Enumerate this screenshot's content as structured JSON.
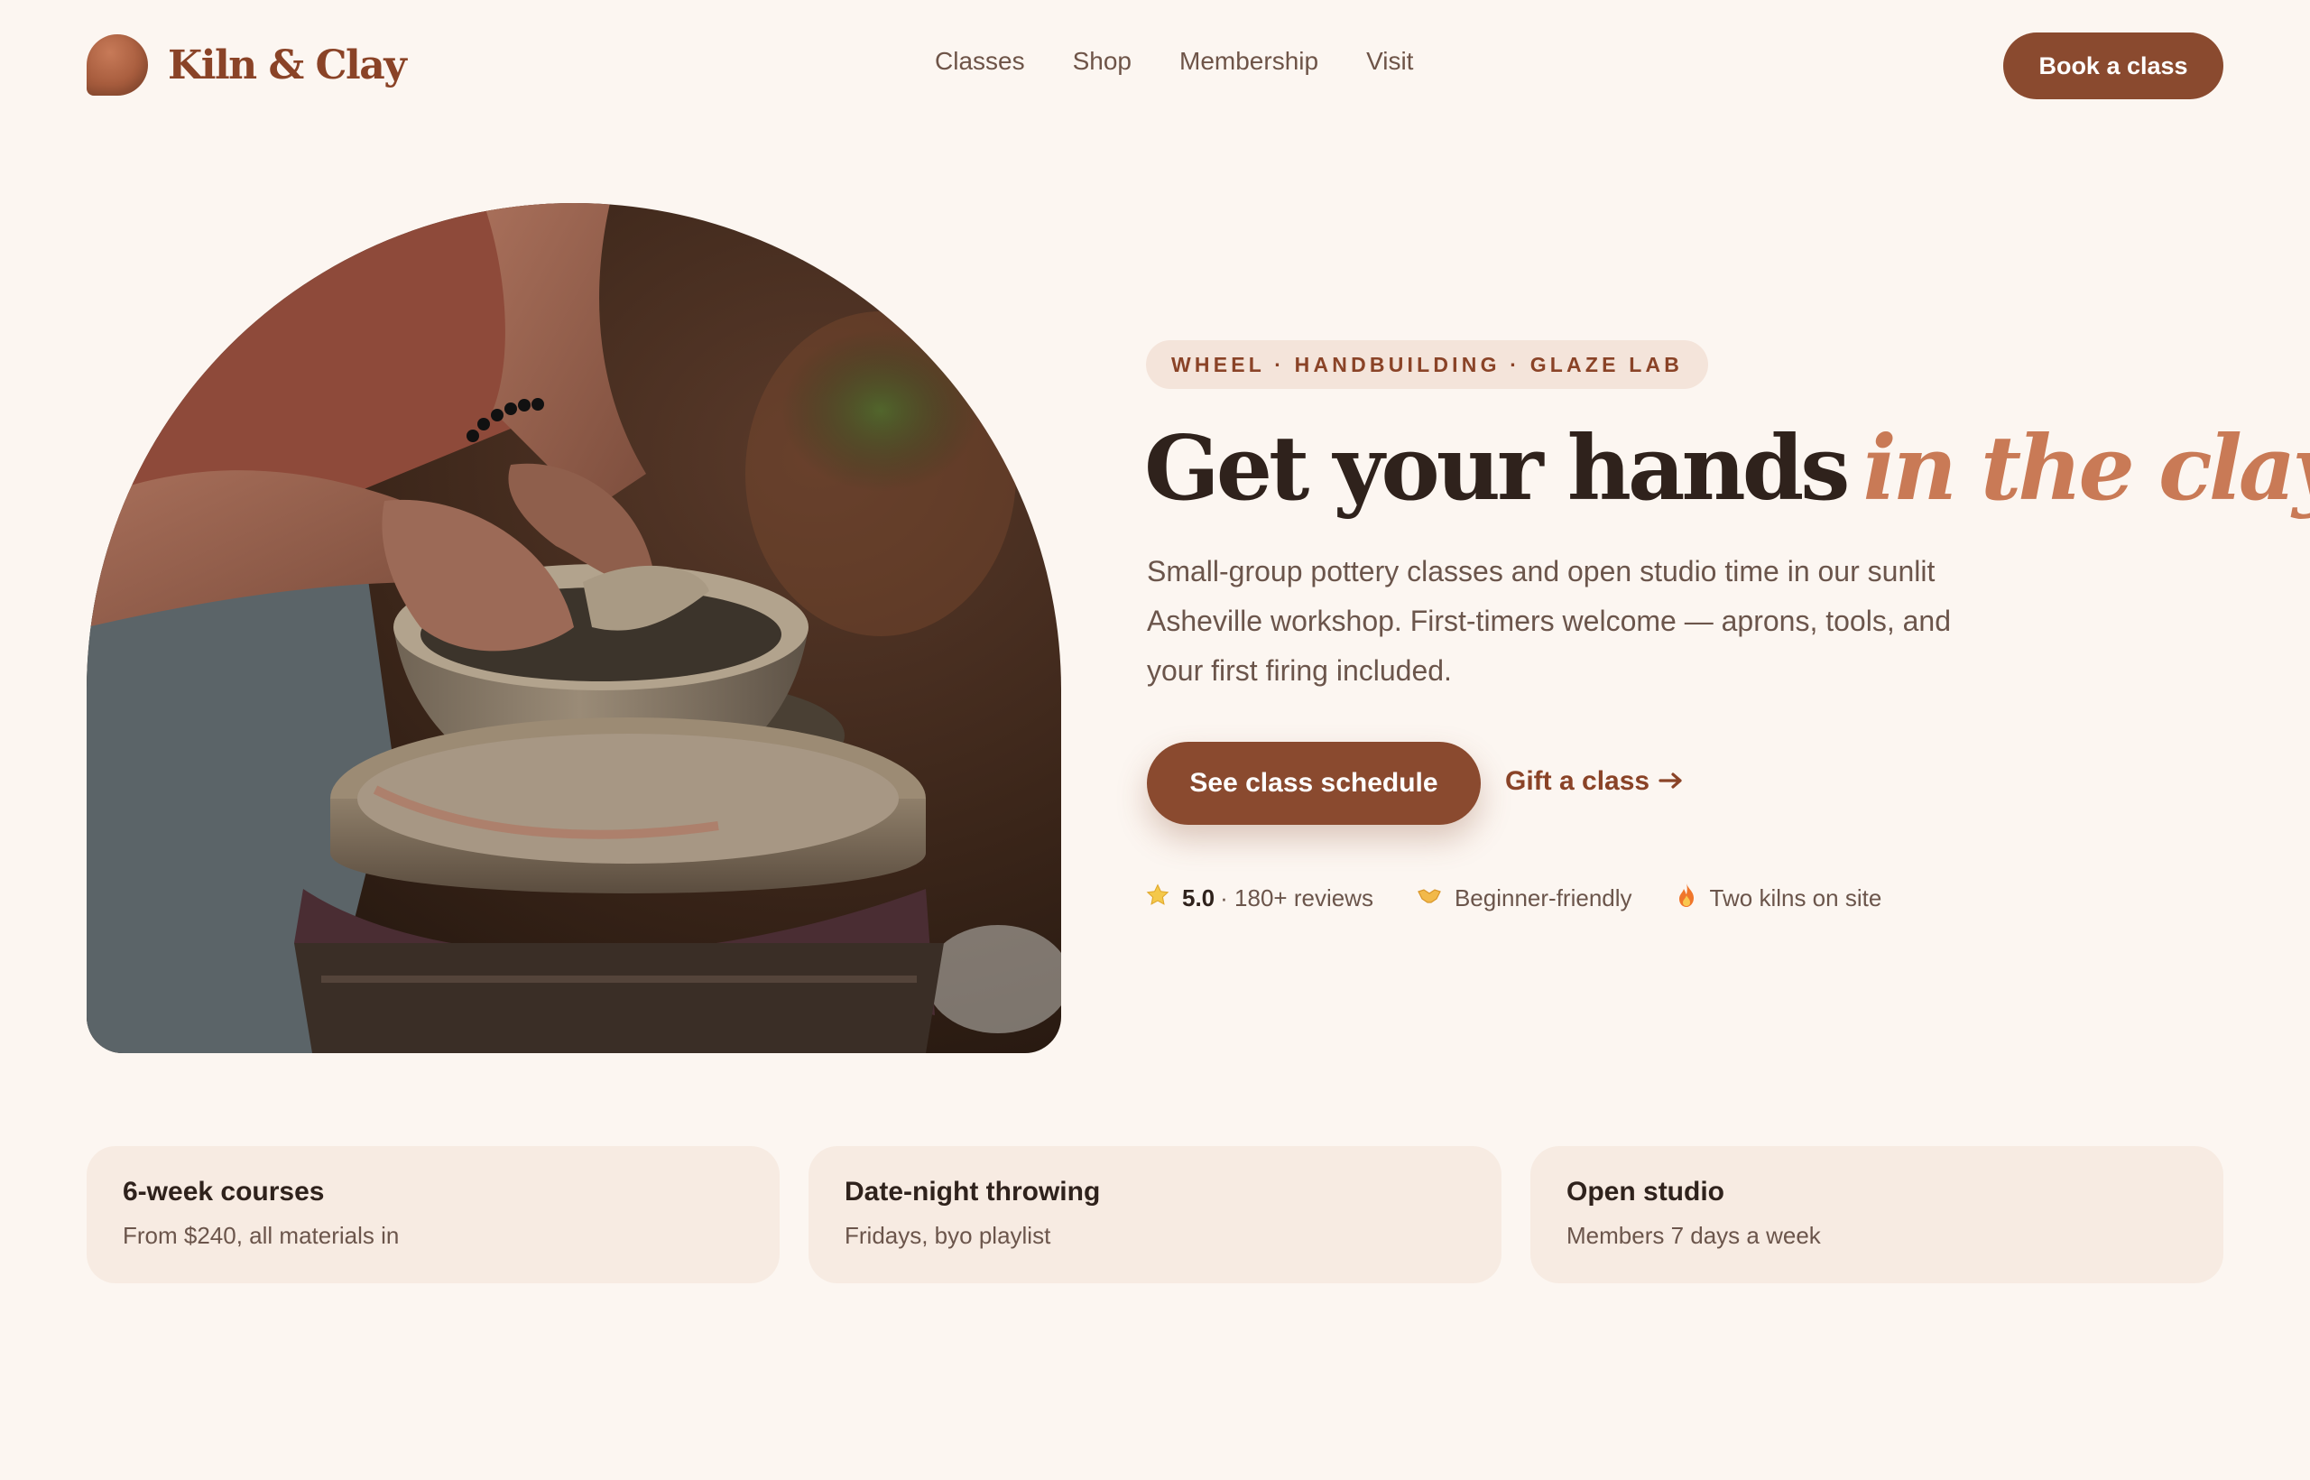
{
  "brand": {
    "name": "Kiln & Clay",
    "accent": "#8a4a2f",
    "accent_light": "#c97a56",
    "background": "#fcf6f1"
  },
  "nav": {
    "items": [
      "Classes",
      "Shop",
      "Membership",
      "Visit"
    ]
  },
  "header": {
    "cta_label": "Book a class"
  },
  "hero": {
    "tagline": "WHEEL · HANDBUILDING · GLAZE LAB",
    "headline_main": "Get your hands",
    "headline_accent": "in the clay",
    "description": "Small-group pottery classes and open studio time in our sunlit Asheville workshop. First-timers welcome — aprons, tools, and your first firing included.",
    "primary_cta": "See class schedule",
    "secondary_cta": "Gift a class",
    "secondary_cta_icon": "arrow-right-icon",
    "image_icon": "pottery-wheel-photo"
  },
  "stats": [
    {
      "icon": "star-icon",
      "strong": "5.0",
      "text": "· 180+ reviews"
    },
    {
      "icon": "handshake-icon",
      "strong": "",
      "text": "Beginner-friendly"
    },
    {
      "icon": "fire-icon",
      "strong": "",
      "text": "Two kilns on site"
    }
  ],
  "cards": [
    {
      "title": "6-week courses",
      "subtitle": "From $240, all materials in"
    },
    {
      "title": "Date-night throwing",
      "subtitle": "Fridays, byo playlist"
    },
    {
      "title": "Open studio",
      "subtitle": "Members 7 days a week"
    }
  ]
}
